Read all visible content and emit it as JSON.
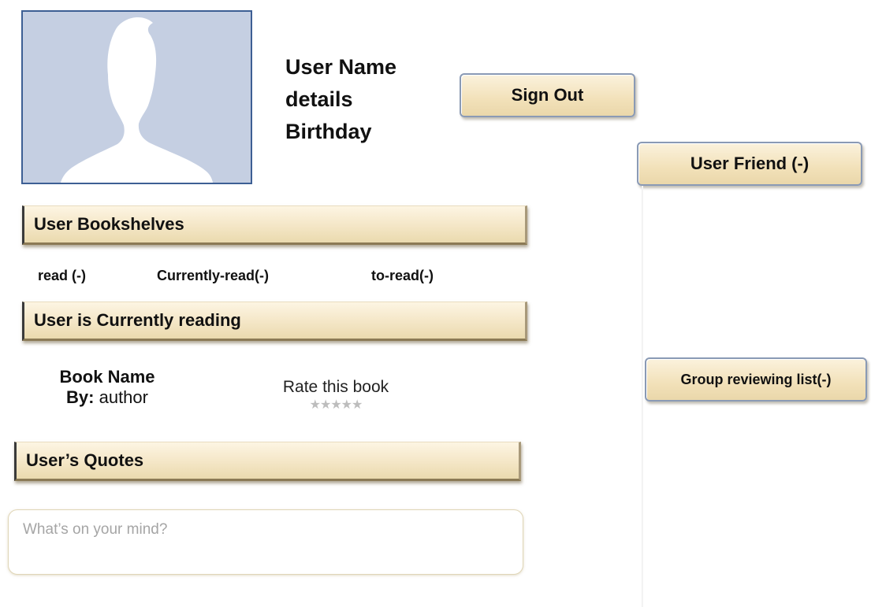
{
  "profile": {
    "avatar_icon": "user-silhouette-icon",
    "name": "User Name",
    "details": "details",
    "birthday": "Birthday"
  },
  "actions": {
    "sign_out_label": "Sign Out"
  },
  "sidebar": {
    "friends_label": "User Friend (-)",
    "groups_label": "Group reviewing list(-)"
  },
  "bookshelves": {
    "title": "User Bookshelves",
    "shelves": [
      "read (-)",
      "Currently-read(-)",
      "to-read(-)"
    ]
  },
  "currently_reading": {
    "title": "User is Currently reading",
    "book_name": "Book Name",
    "by_label": "By:",
    "author": "author",
    "rate_label": "Rate this book",
    "stars": "★★★★★",
    "rating": 0
  },
  "quotes": {
    "title": "User’s Quotes",
    "placeholder": "What’s on your mind?"
  }
}
